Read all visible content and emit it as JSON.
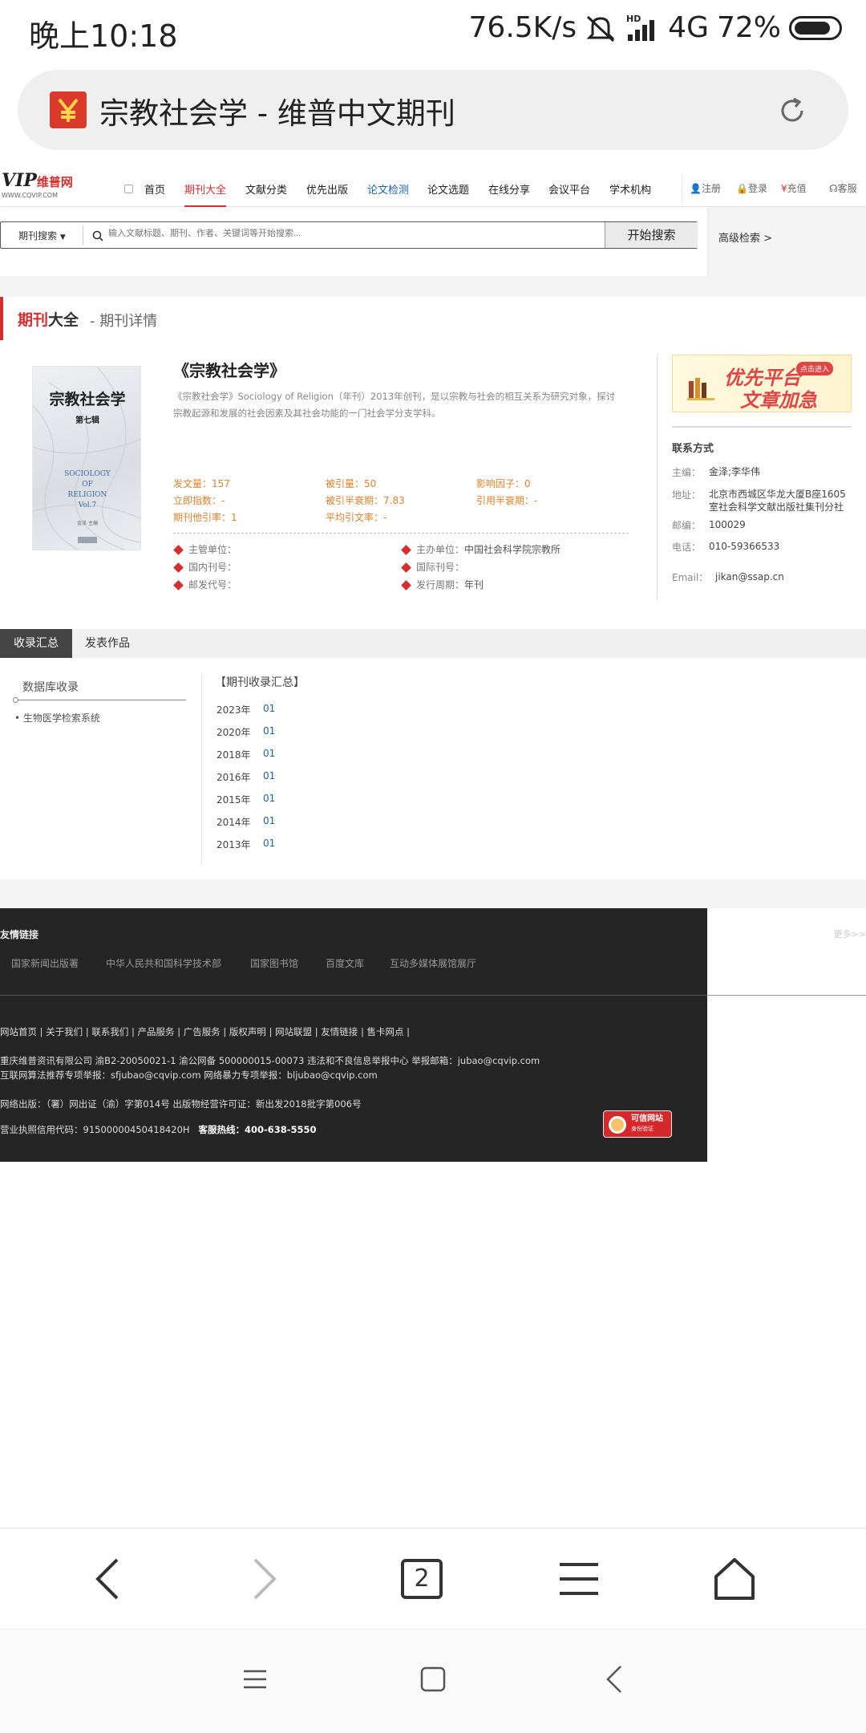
{
  "status_bar": {
    "time": "晚上10:18",
    "speed": "76.5K/s",
    "network": "4G",
    "battery": "72%"
  },
  "browser": {
    "page_title": "宗教社会学 - 维普中文期刊",
    "tab_count": "2"
  },
  "site": {
    "logo_vip": "VIP",
    "logo_cn": "维普网",
    "logo_url": "WWW.CQVIP.COM",
    "nav": [
      "首页",
      "期刊大全",
      "文献分类",
      "优先出版",
      "论文检测",
      "论文选题",
      "在线分享",
      "会议平台",
      "学术机构"
    ],
    "account": [
      "注册",
      "登录",
      "充值",
      "客服"
    ]
  },
  "search": {
    "type_label": "期刊搜索",
    "placeholder": "输入文献标题、期刊、作者、关键词等开始搜索...",
    "button": "开始搜索",
    "advanced": "高级检索 >"
  },
  "breadcrumb": {
    "red": "期刊",
    "black": "大全",
    "sub": "- 期刊详情"
  },
  "journal": {
    "cover_title": "宗教社会学",
    "cover_issue": "第七辑",
    "cover_en": [
      "SOCIOLOGY",
      "OF",
      "RELIGION",
      "Vol.7"
    ],
    "cover_editor": "金泽 主编",
    "title": "《宗教社会学》",
    "description": "《宗教社会学》Sociology of Religion（年刊）2013年创刊，是以宗教与社会的相互关系为研究对象，探讨宗教起源和发展的社会因素及其社会功能的一门社会学分支学科。",
    "stats": [
      {
        "label": "发文量：",
        "value": "157"
      },
      {
        "label": "被引量：",
        "value": "50"
      },
      {
        "label": "影响因子：",
        "value": "0"
      },
      {
        "label": "立即指数：",
        "value": "-"
      },
      {
        "label": "被引半衰期：",
        "value": "7.83"
      },
      {
        "label": "引用半衰期：",
        "value": "-"
      },
      {
        "label": "期刊他引率：",
        "value": "1"
      },
      {
        "label": "平均引文率：",
        "value": "-"
      }
    ],
    "meta": [
      {
        "label": "主管单位：",
        "value": ""
      },
      {
        "label": "主办单位：",
        "value": "中国社会科学院宗教所"
      },
      {
        "label": "国内刊号：",
        "value": ""
      },
      {
        "label": "国际刊号：",
        "value": ""
      },
      {
        "label": "邮发代号：",
        "value": ""
      },
      {
        "label": "发行周期：",
        "value": "年刊"
      }
    ]
  },
  "ad": {
    "text_line1": "优先平台",
    "text_line2": "文章加急",
    "badge": "点击进入"
  },
  "contact": {
    "title": "联系方式",
    "chief_label": "主编：",
    "chief": "金泽;李华伟",
    "address_label": "地址：",
    "address": "北京市西城区华龙大厦B座1605室社会科学文献出版社集刊分社",
    "postcode_label": "邮编：",
    "postcode": "100029",
    "phone_label": "电话：",
    "phone": "010-59366533",
    "email_label": "Email：",
    "email": "jikan@ssap.cn"
  },
  "tabs": [
    "收录汇总",
    "发表作品"
  ],
  "collection": {
    "db_title": "数据库收录",
    "db_item": "• 生物医学检索系统",
    "summary_title": "【期刊收录汇总】",
    "years": [
      {
        "year": "2023年",
        "issue": "01"
      },
      {
        "year": "2020年",
        "issue": "01"
      },
      {
        "year": "2018年",
        "issue": "01"
      },
      {
        "year": "2016年",
        "issue": "01"
      },
      {
        "year": "2015年",
        "issue": "01"
      },
      {
        "year": "2014年",
        "issue": "01"
      },
      {
        "year": "2013年",
        "issue": "01"
      }
    ]
  },
  "footer": {
    "links_title": "友情链接",
    "more": "更多>>",
    "links": [
      "国家新闻出版署",
      "中华人民共和国科学技术部",
      "国家图书馆",
      "百度文库",
      "互动多媒体展馆展厅"
    ],
    "nav_line": "网站首页 | 关于我们 | 联系我们 | 产品服务 | 广告服务 | 版权声明 | 网站联盟 | 友情链接 | 售卡网点 |",
    "line1": "重庆维普资讯有限公司 渝B2-20050021-1 渝公网备 500000015-00073 违法和不良信息举报中心 举报邮箱：jubao@cqvip.com",
    "line2": "互联网算法推荐专项举报：sfjubao@cqvip.com    网络暴力专项举报：bljubao@cqvip.com",
    "line3": "网络出版：（署）网出证（渝）字第014号    出版物经营许可证：新出发2018批字第006号",
    "line4_prefix": "营业执照信用代码：91500000450418420H",
    "line4_hotline": "客服热线：400-638-5550",
    "trust_line1": "可信网站",
    "trust_line2": "身份验证"
  },
  "colors": {
    "brand_red": "#d62f2f",
    "stat_orange": "#e0802a",
    "link_blue": "#1a63b3",
    "footer_bg": "#252525"
  }
}
